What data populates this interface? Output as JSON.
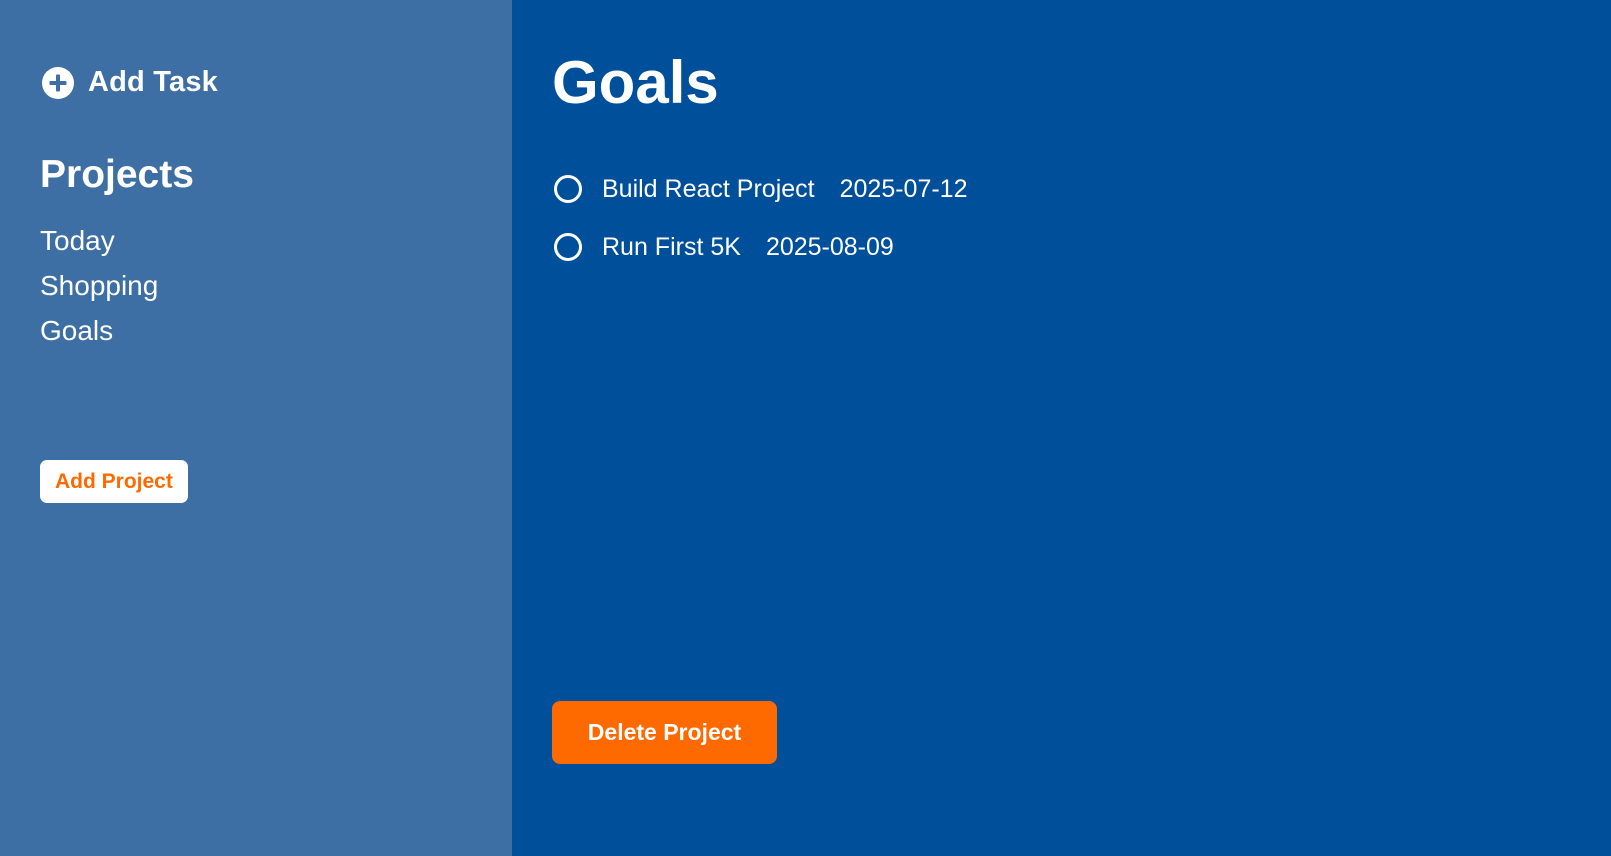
{
  "colors": {
    "sidebar_bg": "#3d6fa5",
    "main_bg": "#004f9b",
    "accent": "#ff6a00",
    "text": "#ffffff"
  },
  "sidebar": {
    "add_task": {
      "icon": "plus-circle-icon",
      "label": "Add Task"
    },
    "projects_heading": "Projects",
    "projects": [
      {
        "label": "Today"
      },
      {
        "label": "Shopping"
      },
      {
        "label": "Goals"
      }
    ],
    "add_project_label": "Add Project"
  },
  "main": {
    "title": "Goals",
    "tasks": [
      {
        "name": "Build React Project",
        "date": "2025-07-12",
        "completed": false
      },
      {
        "name": "Run First 5K",
        "date": "2025-08-09",
        "completed": false
      }
    ],
    "delete_label": "Delete Project"
  }
}
